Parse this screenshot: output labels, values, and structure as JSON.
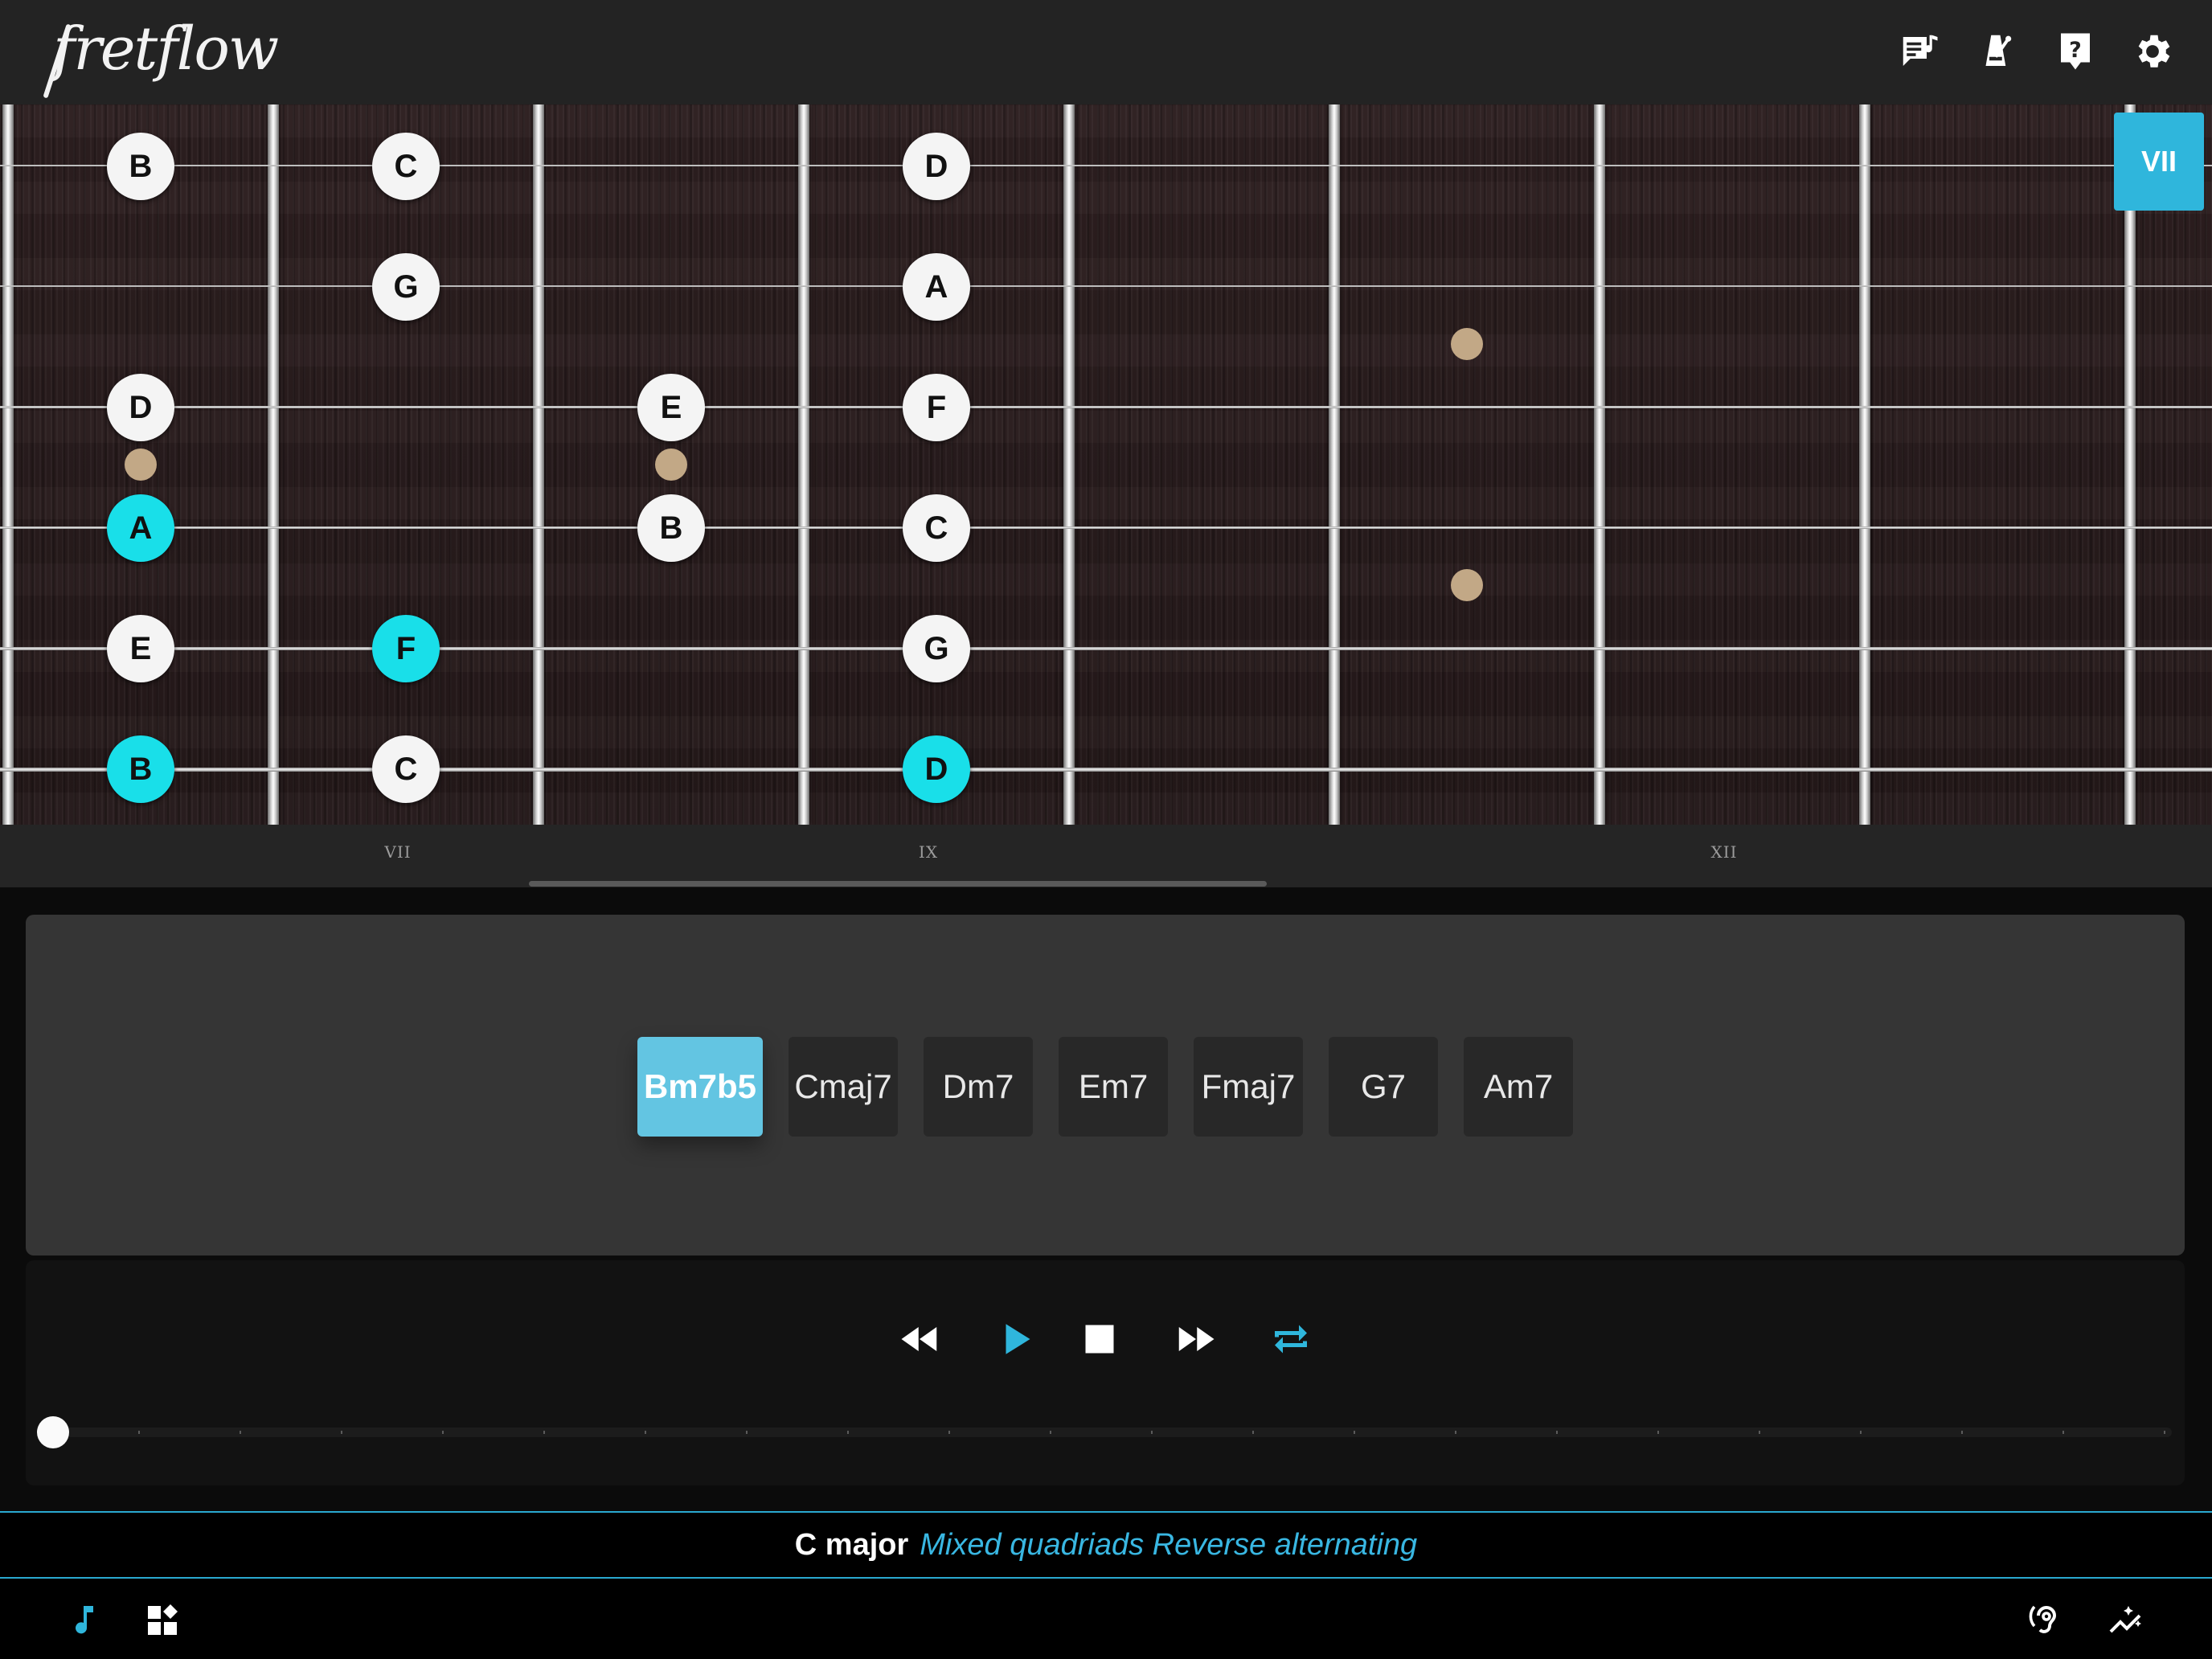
{
  "app": {
    "logo_text": "fretflow"
  },
  "toolbar": {
    "icons": [
      "lesson-notes-icon",
      "metronome-icon",
      "help-icon",
      "settings-icon"
    ]
  },
  "fretboard": {
    "position_badge": "VII",
    "fret_labels": [
      "VII",
      "IX",
      "XII"
    ],
    "strings": [
      {
        "notes": [
          {
            "label": "B",
            "fret": 7,
            "root": false
          },
          {
            "label": "C",
            "fret": 8,
            "root": false
          },
          {
            "label": "D",
            "fret": 10,
            "root": false
          }
        ]
      },
      {
        "notes": [
          {
            "label": "G",
            "fret": 8,
            "root": false
          },
          {
            "label": "A",
            "fret": 10,
            "root": false
          }
        ]
      },
      {
        "notes": [
          {
            "label": "D",
            "fret": 7,
            "root": false
          },
          {
            "label": "E",
            "fret": 9,
            "root": false
          },
          {
            "label": "F",
            "fret": 10,
            "root": false
          }
        ]
      },
      {
        "notes": [
          {
            "label": "A",
            "fret": 7,
            "root": true
          },
          {
            "label": "B",
            "fret": 9,
            "root": false
          },
          {
            "label": "C",
            "fret": 10,
            "root": false
          }
        ]
      },
      {
        "notes": [
          {
            "label": "E",
            "fret": 7,
            "root": false
          },
          {
            "label": "F",
            "fret": 8,
            "root": true
          },
          {
            "label": "G",
            "fret": 10,
            "root": false
          }
        ]
      },
      {
        "notes": [
          {
            "label": "B",
            "fret": 7,
            "root": true
          },
          {
            "label": "C",
            "fret": 8,
            "root": false
          },
          {
            "label": "D",
            "fret": 10,
            "root": true
          }
        ]
      }
    ],
    "colors": {
      "note": "#f4f4f4",
      "root_note": "#19dfe9",
      "inlay": "#c2a886",
      "badge": "#2fb6dc"
    }
  },
  "chords": {
    "items": [
      "Bm7b5",
      "Cmaj7",
      "Dm7",
      "Em7",
      "Fmaj7",
      "G7",
      "Am7"
    ],
    "active_index": 0,
    "active_color": "#63c5e2"
  },
  "transport": {
    "icons": [
      "rewind-icon",
      "play-icon",
      "stop-icon",
      "fast-forward-icon",
      "repeat-icon"
    ],
    "progress": 0,
    "accent": "#2fb6dc"
  },
  "status": {
    "key": "C major",
    "mode": "Mixed quadriads Reverse alternating"
  },
  "bottombar": {
    "left_icons": [
      "music-note-icon",
      "widgets-icon"
    ],
    "right_icons": [
      "ear-training-icon",
      "auto-graph-icon"
    ]
  }
}
